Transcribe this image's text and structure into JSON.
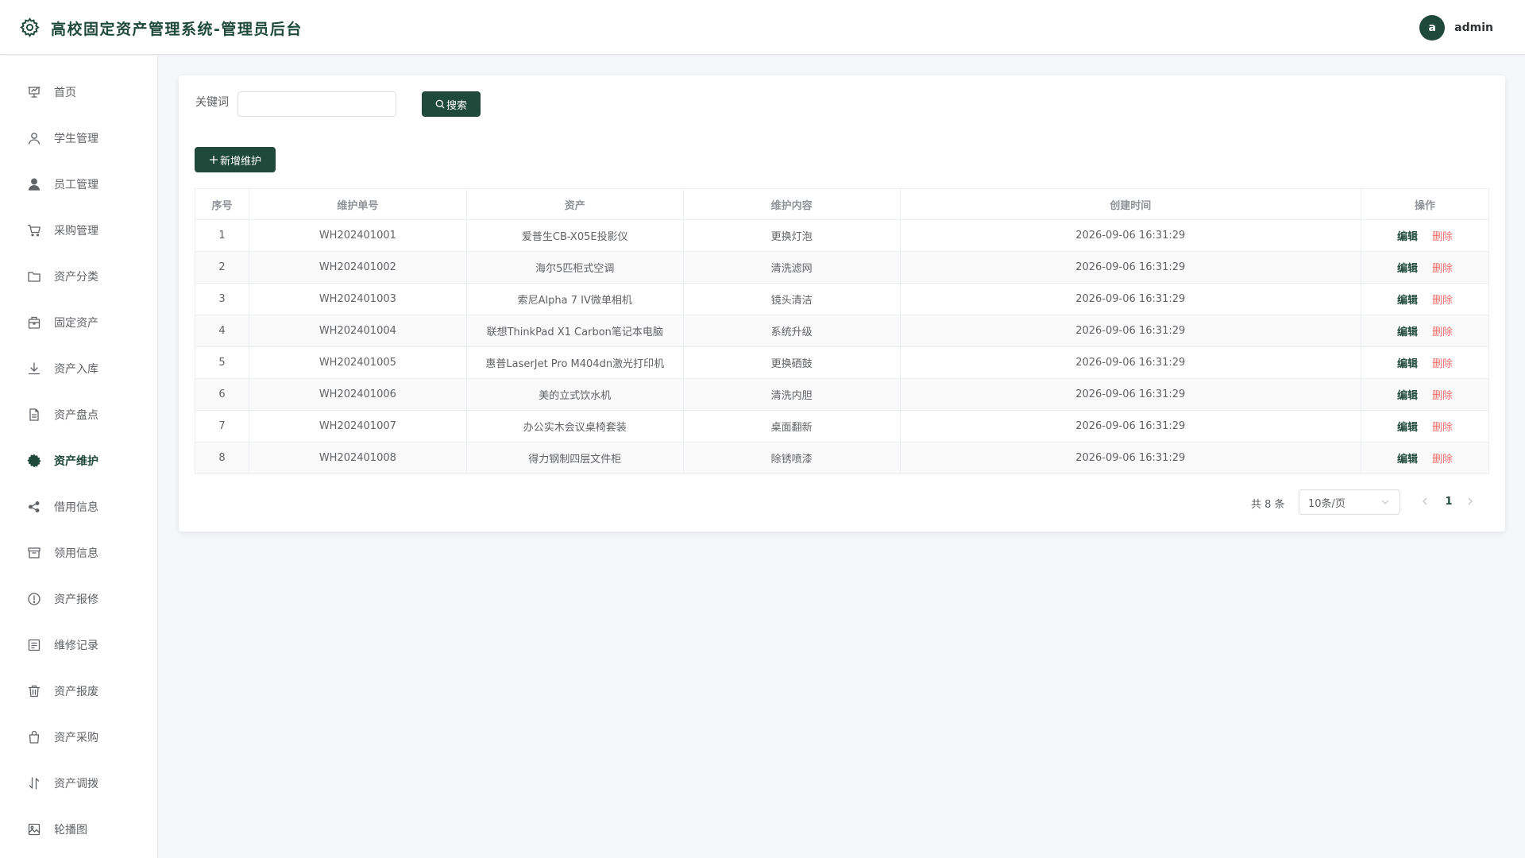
{
  "header": {
    "title": "高校固定资产管理系统-管理员后台",
    "avatar_letter": "a",
    "username": "admin"
  },
  "sidebar": {
    "active_index": 8,
    "items": [
      {
        "label": "首页",
        "icon": "dashboard-icon"
      },
      {
        "label": "学生管理",
        "icon": "user-icon"
      },
      {
        "label": "员工管理",
        "icon": "user-filled-icon"
      },
      {
        "label": "采购管理",
        "icon": "cart-icon"
      },
      {
        "label": "资产分类",
        "icon": "folder-icon"
      },
      {
        "label": "固定资产",
        "icon": "briefcase-icon"
      },
      {
        "label": "资产入库",
        "icon": "download-icon"
      },
      {
        "label": "资产盘点",
        "icon": "document-icon"
      },
      {
        "label": "资产维护",
        "icon": "gear-icon"
      },
      {
        "label": "借用信息",
        "icon": "share-icon"
      },
      {
        "label": "领用信息",
        "icon": "box-icon"
      },
      {
        "label": "资产报修",
        "icon": "warning-icon"
      },
      {
        "label": "维修记录",
        "icon": "tickets-icon"
      },
      {
        "label": "资产报废",
        "icon": "trash-icon"
      },
      {
        "label": "资产采购",
        "icon": "shopping-bag-icon"
      },
      {
        "label": "资产调拨",
        "icon": "sort-icon"
      },
      {
        "label": "轮播图",
        "icon": "picture-icon"
      }
    ]
  },
  "search": {
    "label": "关键词",
    "value": "",
    "placeholder": "",
    "button_label": "搜索"
  },
  "toolbar": {
    "add_label": "新增维护"
  },
  "table": {
    "columns": [
      "序号",
      "维护单号",
      "资产",
      "维护内容",
      "创建时间",
      "操作"
    ],
    "rows": [
      {
        "index": "1",
        "code": "WH202401001",
        "asset": "爱普生CB-X05E投影仪",
        "content": "更换灯泡",
        "created": "2026-09-06 16:31:29"
      },
      {
        "index": "2",
        "code": "WH202401002",
        "asset": "海尔5匹柜式空调",
        "content": "清洗滤网",
        "created": "2026-09-06 16:31:29"
      },
      {
        "index": "3",
        "code": "WH202401003",
        "asset": "索尼Alpha 7 IV微单相机",
        "content": "镜头清洁",
        "created": "2026-09-06 16:31:29"
      },
      {
        "index": "4",
        "code": "WH202401004",
        "asset": "联想ThinkPad X1 Carbon笔记本电脑",
        "content": "系统升级",
        "created": "2026-09-06 16:31:29"
      },
      {
        "index": "5",
        "code": "WH202401005",
        "asset": "惠普LaserJet Pro M404dn激光打印机",
        "content": "更换硒鼓",
        "created": "2026-09-06 16:31:29"
      },
      {
        "index": "6",
        "code": "WH202401006",
        "asset": "美的立式饮水机",
        "content": "清洗内胆",
        "created": "2026-09-06 16:31:29"
      },
      {
        "index": "7",
        "code": "WH202401007",
        "asset": "办公实木会议桌椅套装",
        "content": "桌面翻新",
        "created": "2026-09-06 16:31:29"
      },
      {
        "index": "8",
        "code": "WH202401008",
        "asset": "得力钢制四层文件柜",
        "content": "除锈喷漆",
        "created": "2026-09-06 16:31:29"
      }
    ],
    "edit_label": "编辑",
    "delete_label": "删除"
  },
  "pagination": {
    "total_text": "共 8 条",
    "page_size": "10条/页",
    "current_page": "1"
  },
  "colors": {
    "primary": "#1f4a3b",
    "danger": "#f56c6c",
    "background": "#f5f7fa"
  }
}
